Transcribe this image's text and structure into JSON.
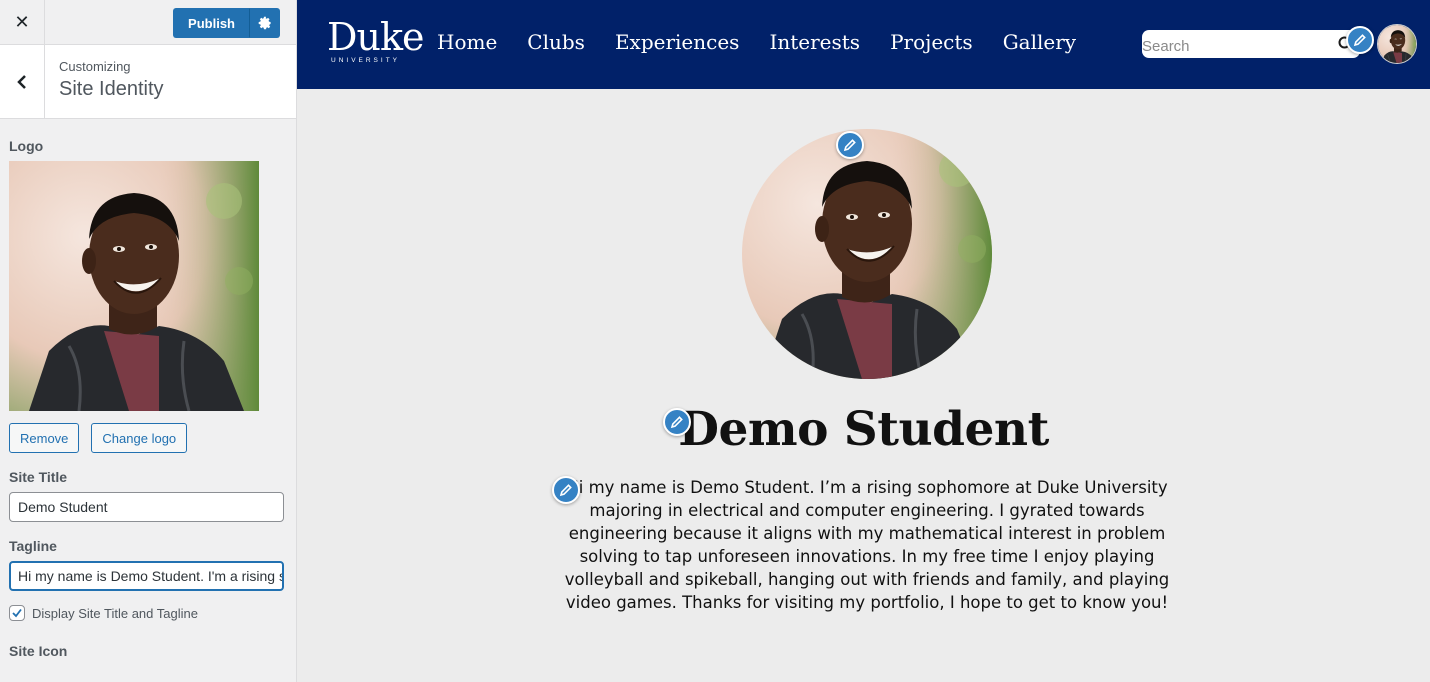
{
  "customizer": {
    "close_label": "✕",
    "publish_label": "Publish",
    "customizing_label": "Customizing",
    "section_title": "Site Identity",
    "logo": {
      "label": "Logo",
      "remove_label": "Remove",
      "change_label": "Change logo"
    },
    "site_title": {
      "label": "Site Title",
      "value": "Demo Student"
    },
    "tagline": {
      "label": "Tagline",
      "value": "Hi my name is Demo Student. I'm a rising sophomore at Duke University"
    },
    "display_title_tagline": {
      "label": "Display Site Title and Tagline",
      "checked": true
    },
    "site_icon": {
      "label": "Site Icon"
    }
  },
  "site": {
    "brand_name": "Duke",
    "brand_sub": "UNIVERSITY",
    "nav": [
      {
        "label": "Home"
      },
      {
        "label": "Clubs"
      },
      {
        "label": "Experiences"
      },
      {
        "label": "Interests"
      },
      {
        "label": "Projects"
      },
      {
        "label": "Gallery"
      }
    ],
    "search_placeholder": "Search",
    "title": "Demo Student",
    "tagline": "Hi my name is Demo Student. I’m a rising sophomore at Duke University majoring in electrical and computer engineering. I gyrated towards engineering because it aligns with my mathematical interest in problem solving to tap unforeseen innovations. In my free time I enjoy playing volleyball and spikeball, hanging out with friends and family, and playing video games. Thanks for visiting my portfolio, I hope to get to know you!"
  },
  "colors": {
    "navbar": "#012169",
    "wp_blue": "#2271b1",
    "edit_badge": "#3582c4",
    "preview_bg": "#ececec"
  },
  "icons": [
    "close-icon",
    "gear-icon",
    "chevron-left-icon",
    "checkmark-icon",
    "search-icon",
    "pencil-icon"
  ]
}
